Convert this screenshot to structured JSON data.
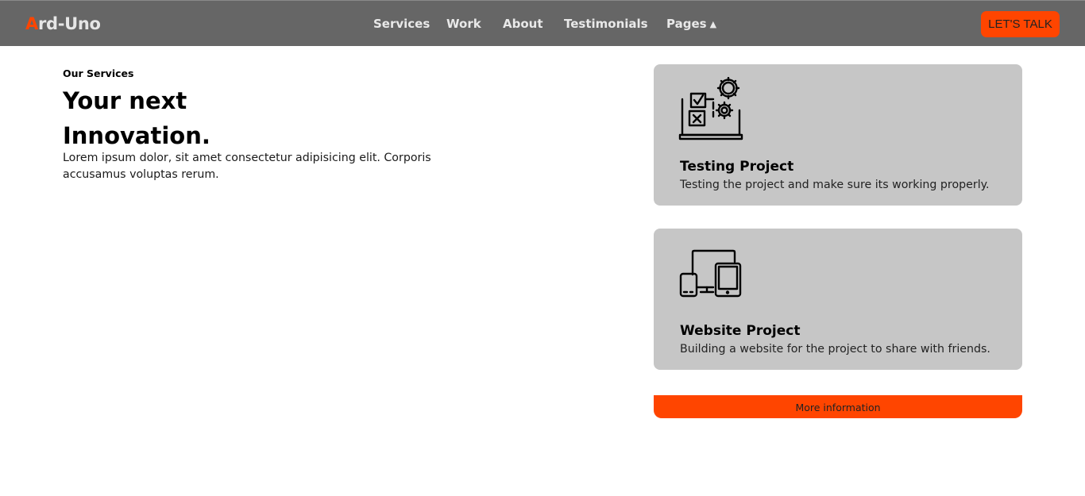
{
  "brand": {
    "first_letter": "A",
    "rest": "rd-Uno",
    "accent_color": "#ff4500"
  },
  "nav": {
    "items": [
      {
        "label": "Services"
      },
      {
        "label": "Work"
      },
      {
        "label": "About"
      },
      {
        "label": "Testimonials"
      },
      {
        "label": "Pages",
        "caret": "▲"
      }
    ],
    "cta_label": "LET'S TALK"
  },
  "intro": {
    "eyebrow": "Our Services",
    "headline": "Your next Innovation.",
    "body": "Lorem ipsum dolor, sit amet consectetur adipisicing elit. Corporis accusamus voluptas rerum."
  },
  "cards": [
    {
      "icon": "testing-checklist-gears-icon",
      "title": "Testing Project",
      "description": "Testing the project and make sure its working properly."
    },
    {
      "icon": "responsive-devices-icon",
      "title": "Website Project",
      "description": "Building a website for the project to share with friends."
    }
  ],
  "more_button_label": "More information"
}
